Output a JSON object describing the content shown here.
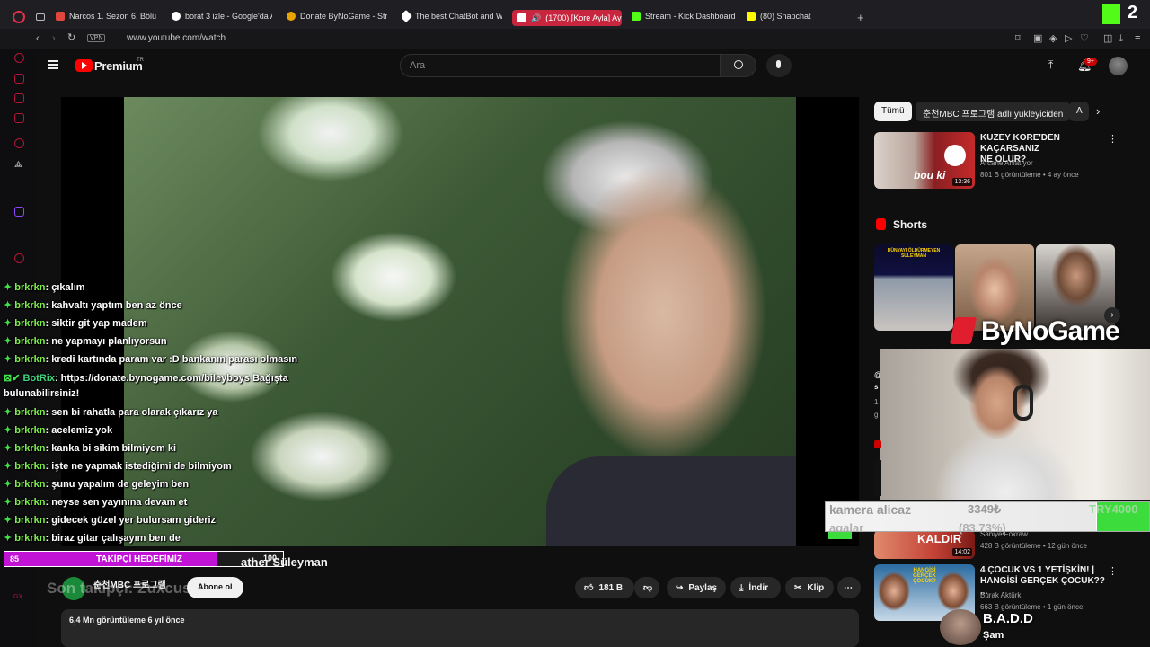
{
  "browser": {
    "tabs": [
      {
        "label": "Narcos 1. Sezon 6. Bölüm",
        "color": "#e0463b"
      },
      {
        "label": "borat 3 izle - Google'da A",
        "color": "#4285f4"
      },
      {
        "label": "Donate ByNoGame - Stre",
        "color": "#e9a400"
      },
      {
        "label": "The best ChatBot and Wi",
        "color": "#ffffff"
      },
      {
        "label": "(1700) [Kore Ayla] Ayl",
        "color": "#ff0000"
      },
      {
        "label": "Stream - Kick Dashboard",
        "color": "#53fc18"
      },
      {
        "label": "(80) Snapchat",
        "color": "#fffc00"
      }
    ],
    "new_tab_symbol": "+",
    "vpn_badge": "VPN",
    "url": "www.youtube.com/watch",
    "kick_badge": "2"
  },
  "youtube": {
    "logo_text": "Premium",
    "logo_region": "TR",
    "search_placeholder": "Ara",
    "notif_count": "9+",
    "video": {
      "title_partial": "ather Süleyman",
      "channel": "춘천MBC 프로그램",
      "channel_overlay": "Son takipçi: Zuxcus",
      "subscribe_label": "Abone ol",
      "likes": "181 B",
      "share_label": "Paylaş",
      "download_label": "İndir",
      "clip_label": "Klip",
      "views_date": "6,4 Mn görüntüleme  6 yıl önce"
    },
    "chips": [
      "Tümü",
      "춘천MBC 프로그램 adlı yükleyiciden",
      "A"
    ],
    "recommendations": [
      {
        "title_line1": "KUZEY KORE'DEN KAÇARSANIZ",
        "title_line2": "NE OLUR?",
        "channel": "Arcane Anlatıyor",
        "meta": "801 B görüntüleme • 4 ay önce",
        "duration": "13:36",
        "thumb_text": "bou ki"
      },
      {
        "title_line1": "",
        "title_line2": "",
        "channel": "Saniye Fokraw",
        "meta": "428 B görüntüleme • 12 gün önce",
        "duration": "14:02",
        "thumb_text": "KALDIR"
      },
      {
        "title_line1": "4 ÇOCUK VS 1 YETİŞKİN! |",
        "title_line2": "HANGİSİ GERÇEK ÇOCUK?? ...",
        "channel": "Burak Aktürk",
        "meta": "663 B görüntüleme • 1 gün önce",
        "duration": "",
        "thumb_text": "HANGİSİ GERÇEK ÇOCUK?"
      }
    ],
    "shorts_label": "Shorts",
    "shorts_thumb_text": "DÜNYAYI ÖLDÜRMEYEN SÜLEYMAN",
    "shorts_caption": "@",
    "shorts_caption2": "s",
    "shorts_caption3": "1",
    "shorts_caption4": "g"
  },
  "stream_overlay": {
    "chat": [
      {
        "user": "brkrkn",
        "text": ": çıkalım"
      },
      {
        "user": "brkrkn",
        "text": ": kahvaltı yaptım ben az önce"
      },
      {
        "user": "brkrkn",
        "text": ": siktir git yap madem"
      },
      {
        "user": "brkrkn",
        "text": ": ne yapmayı planlıyorsun"
      },
      {
        "user": "brkrkn",
        "text": ": kredi kartında param var :D bankanın parası olmasın"
      },
      {
        "user": "BotRix",
        "text": ": https://donate.bynogame.com/bileyboys Bağışta",
        "cont": "bulunabilirsiniz!"
      },
      {
        "user": "brkrkn",
        "text": ": sen bi rahatla para olarak çıkarız ya"
      },
      {
        "user": "brkrkn",
        "text": ": acelemiz yok"
      },
      {
        "user": "brkrkn",
        "text": ": kanka bi sikim bilmiyom ki"
      },
      {
        "user": "brkrkn",
        "text": ": işte ne yapmak istediğimi de bilmiyom"
      },
      {
        "user": "brkrkn",
        "text": ": şunu yapalım de geleyim ben"
      },
      {
        "user": "brkrkn",
        "text": ": neyse sen yayınına devam et"
      },
      {
        "user": "brkrkn",
        "text": ": gidecek güzel yer bulursam gideriz"
      },
      {
        "user": "brkrkn",
        "text": ": biraz gitar çalışayım ben de"
      }
    ],
    "goal": {
      "current": "85",
      "label": "TAKİPÇİ HEDEFİMİZ",
      "target": "100",
      "progress": 0.85
    },
    "donation": {
      "title": "kamera alicaz",
      "sub": "agalar",
      "amount": "3349₺",
      "percent": "(83.73%)",
      "target": "TRY4000",
      "progress": 0.8373
    },
    "sponsor_logo": "ByNoGame",
    "badd_name": "B.A.D.D",
    "badd_sub": "Şam",
    "side_label": "GX"
  },
  "colors": {
    "accent_red": "#ff0000",
    "kick_green": "#53fc18",
    "goal_purple": "#c113d6"
  }
}
